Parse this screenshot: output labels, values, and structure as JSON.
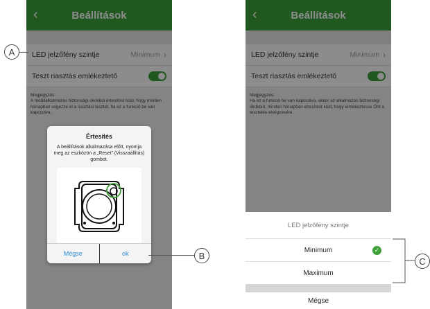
{
  "left_screen": {
    "header": {
      "back_icon": "chevron-left-icon",
      "title": "Beállítások"
    },
    "led_row": {
      "label": "LED jelzőfény szintje",
      "value": "Minimum"
    },
    "test_row": {
      "label": "Teszt riasztás emlékeztető",
      "toggle_on": true
    },
    "note": {
      "heading": "Megjegyzés:",
      "text": "A mobilalkalmazás biztonsági okokból értesítést küld, hogy minden hónapban végezze el a riasztási tesztet, ha ez a funkció be van kapcsolva."
    },
    "dialog": {
      "title": "Értesítés",
      "message": "A beállítások alkalmazása előtt, nyomja meg az eszközön a „Reset” (Visszaállítás) gombot.",
      "cancel_label": "Mégse",
      "ok_label": "ok"
    }
  },
  "right_screen": {
    "header": {
      "back_icon": "chevron-left-icon",
      "title": "Beállítások"
    },
    "led_row": {
      "label": "LED jelzőfény szintje",
      "value": "Minimum"
    },
    "test_row": {
      "label": "Teszt riasztás emlékeztető",
      "toggle_on": true
    },
    "note": {
      "heading": "Megjegyzés:",
      "text": "Ha ez a funkció be van kapcsolva, akkor az alkalmazás biztonsági okokból, minden hónapban értesítést küld, hogy emlékeztesse Önt a tesztelés elvégzésére."
    },
    "sheet": {
      "title": "LED jelzőfény szintje",
      "options": [
        "Minimum",
        "Maximum"
      ],
      "selected": "Minimum",
      "cancel_label": "Mégse"
    }
  },
  "callouts": {
    "a": "A",
    "b": "B",
    "c": "C"
  },
  "colors": {
    "accent": "#3da03a",
    "link": "#2a8fd6"
  }
}
